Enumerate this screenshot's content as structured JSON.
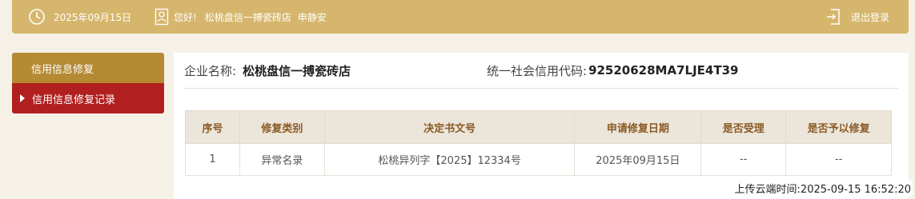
{
  "topbar": {
    "date": "2025年09月15日",
    "greeting": "您好!",
    "store": "松桃盘信一搏瓷砖店",
    "person": "申静安",
    "logout": "退出登录"
  },
  "sidebar": {
    "header": "信用信息修复",
    "items": [
      {
        "label": "信用信息修复记录"
      }
    ]
  },
  "company": {
    "name_label": "企业名称:",
    "name": "松桃盘信一搏瓷砖店",
    "code_label": "统一社会信用代码:",
    "code": "92520628MA7LJE4T39"
  },
  "table": {
    "headers": [
      "序号",
      "修复类别",
      "决定书文号",
      "申请修复日期",
      "是否受理",
      "是否予以修复"
    ],
    "rows": [
      [
        "1",
        "异常名录",
        "松桃异列字【2025】12334号",
        "2025年09月15日",
        "--",
        "--"
      ]
    ]
  },
  "footer": {
    "label": "上传云端时间:",
    "time": "2025-09-15 16:52:20"
  },
  "colors": {
    "topbar": "#d6b66c",
    "sidebar_header": "#b58a33",
    "sidebar_active": "#b1201f",
    "table_header_bg": "#ece5d9",
    "table_header_text": "#8a5a25"
  }
}
